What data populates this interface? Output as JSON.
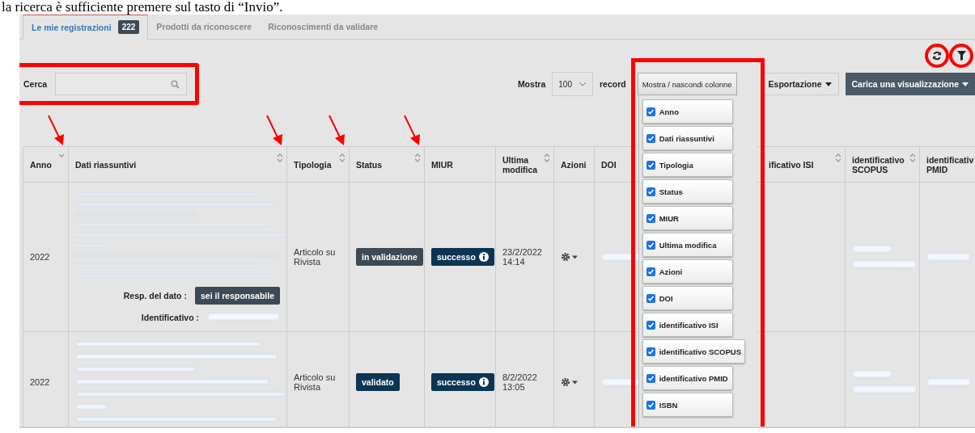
{
  "document_text": "la ricerca è sufficiente premere sul tasto di “Invio”.",
  "tabs": [
    {
      "label": "Le mie registrazioni",
      "badge": "222",
      "selected": true
    },
    {
      "label": "Prodotti da riconoscere",
      "selected": false
    },
    {
      "label": "Riconoscimenti da validare",
      "selected": false
    }
  ],
  "tool_buttons": [
    {
      "kind": "refresh",
      "highlighted": true
    },
    {
      "kind": "filter",
      "highlighted": true
    }
  ],
  "search": {
    "label": "Cerca",
    "highlighted": true
  },
  "page_size": {
    "label": "Mostra",
    "value": "100",
    "suffix": "record"
  },
  "columns_button": {
    "label": "Mostra / nascondi colonne",
    "highlighted": true
  },
  "export_button": "Esportazione",
  "load_view_button": "Carica una visualizzazione",
  "column_menu": [
    {
      "label": "Anno",
      "checked": true
    },
    {
      "label": "Dati riassuntivi",
      "checked": true
    },
    {
      "label": "Tipologia",
      "checked": true
    },
    {
      "label": "Status",
      "checked": true
    },
    {
      "label": "MIUR",
      "checked": true
    },
    {
      "label": "Ultima modifica",
      "checked": true
    },
    {
      "label": "Azioni",
      "checked": true
    },
    {
      "label": "DOI",
      "checked": true
    },
    {
      "label": "identificativo ISI",
      "checked": true
    },
    {
      "label": "identificativo SCOPUS",
      "checked": true
    },
    {
      "label": "identificativo PMID",
      "checked": true
    },
    {
      "label": "ISBN",
      "checked": true
    }
  ],
  "table": {
    "columns": [
      {
        "label": "Anno",
        "sortable": true,
        "sorted": true,
        "marked": true
      },
      {
        "label": "Dati riassuntivi",
        "sortable": true,
        "sorted": false,
        "marked": true
      },
      {
        "label": "Tipologia",
        "sortable": true,
        "sorted": false,
        "marked": true
      },
      {
        "label": "Status",
        "sortable": true,
        "sorted": false,
        "marked": true
      },
      {
        "label": "MIUR",
        "sortable": false,
        "marked": false
      },
      {
        "label": "Ultima modifica",
        "sortable": true,
        "sorted": false,
        "marked": false
      },
      {
        "label": "Azioni",
        "sortable": false,
        "marked": false
      },
      {
        "label": "DOI",
        "sortable": false,
        "marked": false
      },
      {
        "label": "ificativo ISI",
        "sortable": true,
        "sorted": false,
        "marked": false
      },
      {
        "label": "identificativo SCOPUS",
        "sortable": true,
        "sorted": false,
        "marked": false
      },
      {
        "label": "identificativ PMID",
        "sortable": false,
        "marked": false
      }
    ],
    "rows": [
      {
        "year": "2022",
        "responsible_label": "Resp. del dato :",
        "responsible_button": "sei il responsabile",
        "identifier_label": "Identificativo :",
        "type": "Articolo su Rivista",
        "status": {
          "label": "in validazione",
          "kind": "pending"
        },
        "miur": "successo",
        "modified": "23/2/2022 14:14"
      },
      {
        "year": "2022",
        "type": "Articolo su Rivista",
        "status": {
          "label": "validato",
          "kind": "validated"
        },
        "miur": "successo",
        "modified": "8/2/2022 13:05"
      }
    ]
  }
}
